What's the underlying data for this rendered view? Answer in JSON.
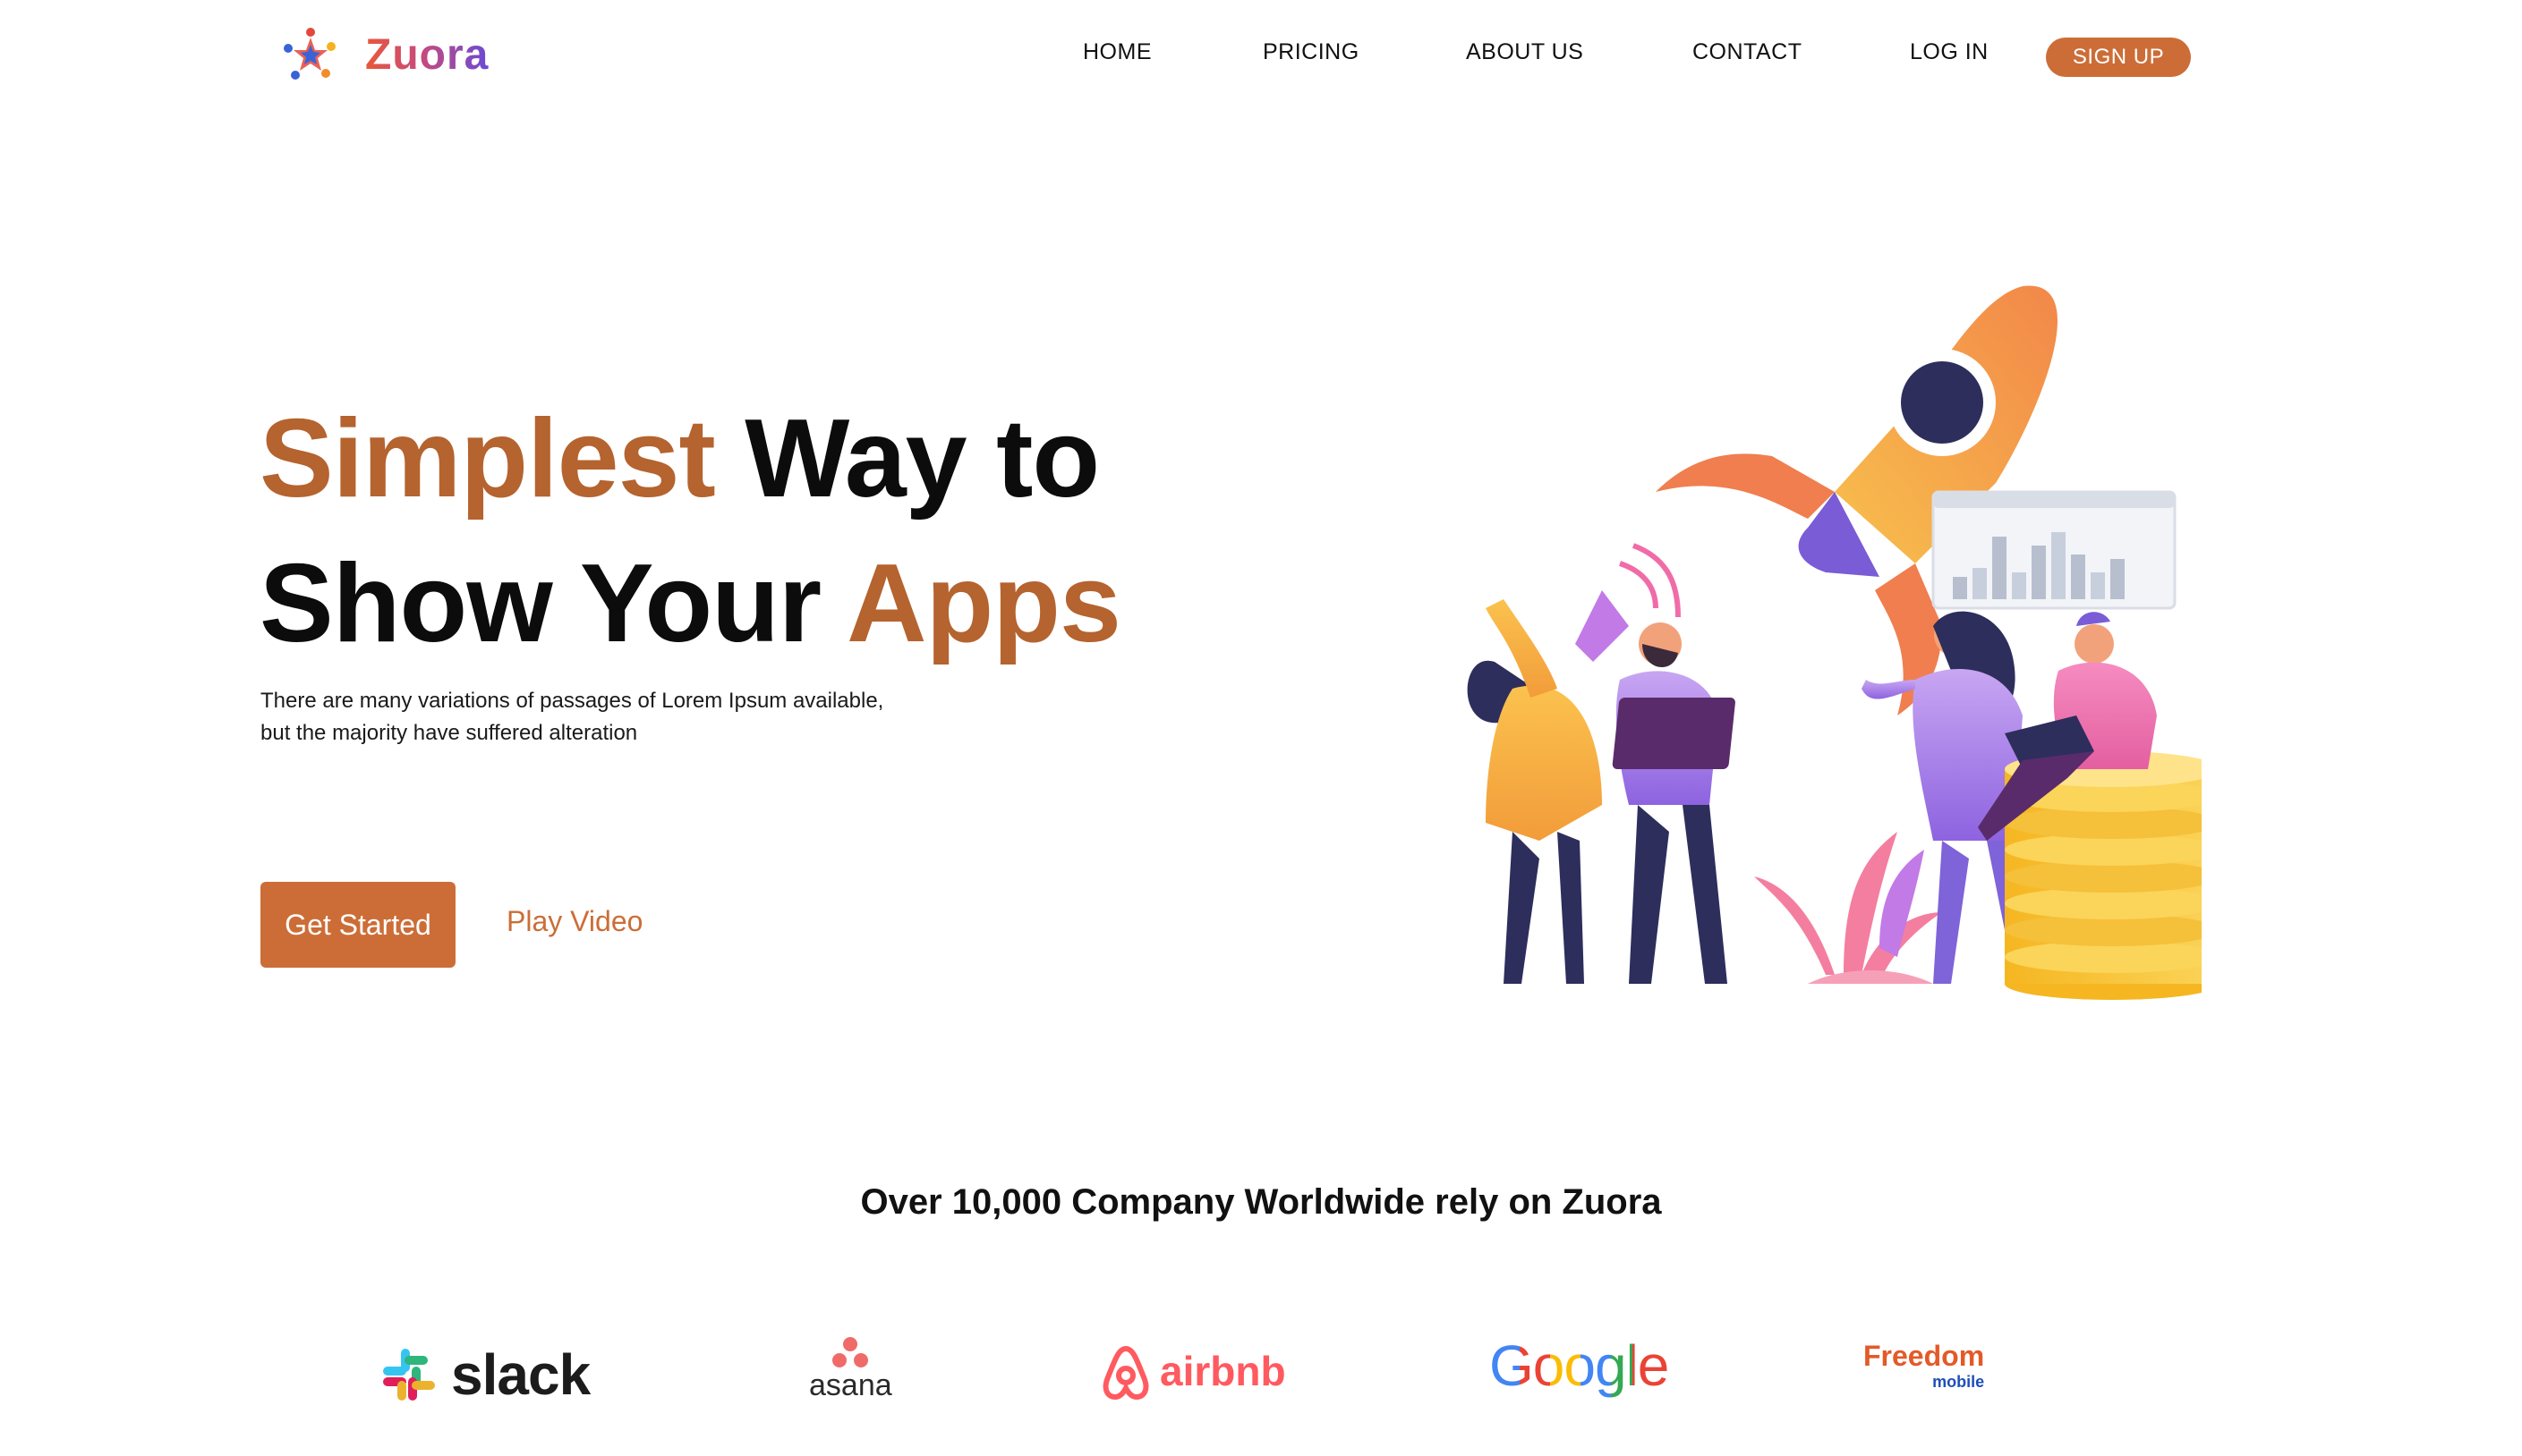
{
  "brand": {
    "name": "Zuora"
  },
  "nav": {
    "home": "HOME",
    "pricing": "PRICING",
    "about": "ABOUT US",
    "contact": "CONTACT",
    "login": "LOG IN",
    "signup": "SIGN UP"
  },
  "hero": {
    "title_part1": "Simplest",
    "title_part2": " Way to",
    "title_part3": "Show Your ",
    "title_part4": "Apps",
    "description": "There are many variations of passages of Lorem Ipsum available, but the majority have suffered alteration",
    "cta_primary": "Get Started",
    "cta_secondary": "Play Video",
    "illustration_icon": "rocket-team-illustration"
  },
  "trust": {
    "title": "Over 10,000 Company Worldwide rely on Zuora",
    "logos": {
      "slack": "slack",
      "asana": "asana",
      "airbnb": "airbnb",
      "google": "Google",
      "freedom": "Freedom",
      "freedom_sub": "mobile"
    }
  },
  "colors": {
    "accent": "#cc6d37",
    "title_accent": "#b5632f"
  }
}
